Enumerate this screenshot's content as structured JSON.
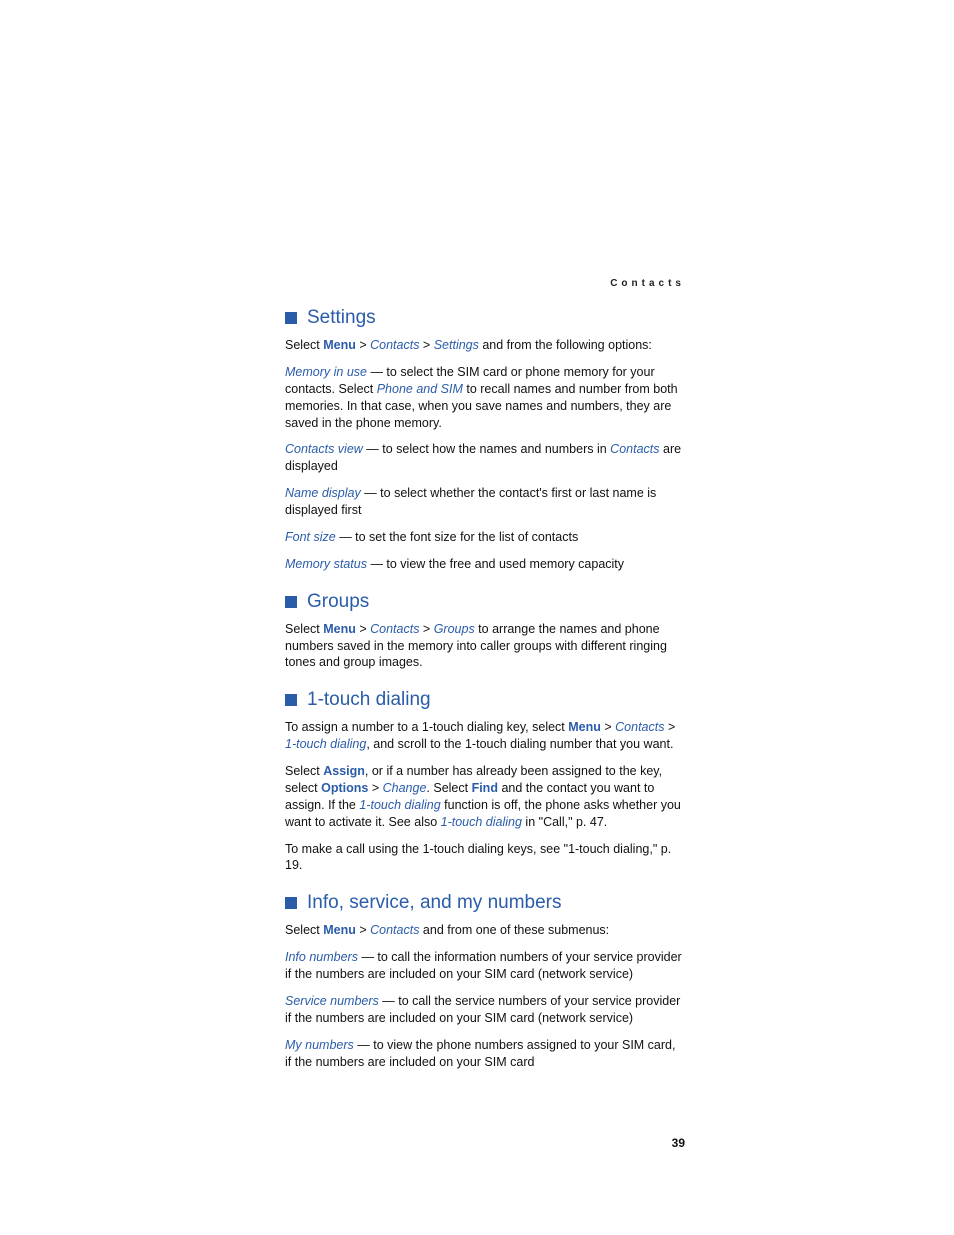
{
  "header": "Contacts",
  "page_number": "39",
  "sections": {
    "settings": {
      "title": "Settings",
      "p1_a": "Select ",
      "p1_menu": "Menu",
      "p1_sep": " > ",
      "p1_contacts": "Contacts",
      "p1_settings": "Settings",
      "p1_b": " and from the following options:",
      "mem_label": "Memory in use",
      "mem_a": " — to select the SIM card or phone memory for your contacts. Select ",
      "mem_phonesim": "Phone and SIM",
      "mem_b": " to recall names and number from both memories. In that case, when you save names and numbers, they are saved in the phone memory.",
      "cv_label": "Contacts view",
      "cv_a": " — to select how the names and numbers in ",
      "cv_contacts": "Contacts",
      "cv_b": " are displayed",
      "nd_label": "Name display",
      "nd_a": " — to select whether the contact's first or last name is displayed first",
      "fs_label": "Font size",
      "fs_a": " — to set the font size for the list of contacts",
      "ms_label": "Memory status",
      "ms_a": " — to view the free and used memory capacity"
    },
    "groups": {
      "title": "Groups",
      "p1_a": "Select ",
      "p1_menu": "Menu",
      "p1_sep": " > ",
      "p1_contacts": "Contacts",
      "p1_groups": "Groups",
      "p1_b": " to arrange the names and phone numbers saved in the memory into caller groups with different ringing tones and group images."
    },
    "onetouch": {
      "title": "1-touch dialing",
      "p1_a": "To assign a number to a 1-touch dialing key, select ",
      "p1_menu": "Menu",
      "p1_sep": " > ",
      "p1_contacts": "Contacts",
      "p1_1touch": "1-touch dialing",
      "p1_b": ", and scroll to the 1-touch dialing number that you want.",
      "p2_a": "Select ",
      "p2_assign": "Assign",
      "p2_b": ", or if a number has already been assigned to the key, select ",
      "p2_options": "Options",
      "p2_change": "Change",
      "p2_c": ". Select ",
      "p2_find": "Find",
      "p2_d": " and the contact you want to assign. If the ",
      "p2_1touch": "1-touch dialing",
      "p2_e": " function is off, the phone asks whether you want to activate it. See also ",
      "p2_1touch2": "1-touch dialing",
      "p2_f": " in \"Call,\" p. 47.",
      "p3": "To make a call using the 1-touch dialing keys, see \"1-touch dialing,\" p. 19."
    },
    "info": {
      "title": "Info, service, and my numbers",
      "p1_a": "Select ",
      "p1_menu": "Menu",
      "p1_sep": " > ",
      "p1_contacts": "Contacts",
      "p1_b": " and from one of these submenus:",
      "in_label": "Info numbers",
      "in_a": " — to call the information numbers of your service provider if the numbers are included on your SIM card (network service)",
      "sn_label": "Service numbers",
      "sn_a": " — to call the service numbers of your service provider if the numbers are included on your SIM card (network service)",
      "mn_label": "My numbers",
      "mn_a": " — to view the phone numbers assigned to your SIM card, if the numbers are included on your SIM card"
    }
  }
}
